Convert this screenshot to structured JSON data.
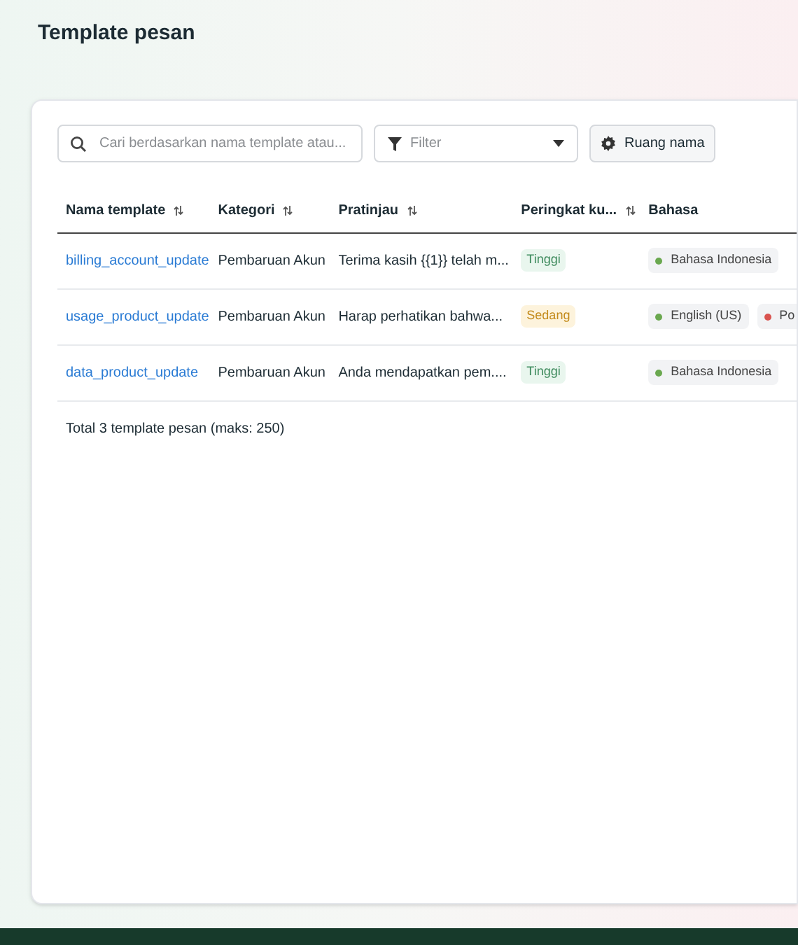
{
  "page_title": "Template pesan",
  "toolbar": {
    "search": {
      "placeholder": "Cari berdasarkan nama template atau..."
    },
    "filter": {
      "placeholder": "Filter"
    },
    "namespace_button": "Ruang nama"
  },
  "table": {
    "columns": [
      {
        "label": "Nama template",
        "sortable": true
      },
      {
        "label": "Kategori",
        "sortable": true
      },
      {
        "label": "Pratinjau",
        "sortable": true
      },
      {
        "label": "Peringkat ku...",
        "sortable": true
      },
      {
        "label": "Bahasa",
        "sortable": false
      }
    ],
    "rows": [
      {
        "name": "billing_account_update",
        "category": "Pembaruan Akun",
        "preview": "Terima kasih {{1}} telah m...",
        "quality": {
          "label": "Tinggi",
          "kind": "high"
        },
        "languages": [
          {
            "label": "Bahasa Indonesia",
            "color": "#6aa84f"
          }
        ]
      },
      {
        "name": "usage_product_update",
        "category": "Pembaruan Akun",
        "preview": "Harap perhatikan bahwa...",
        "quality": {
          "label": "Sedang",
          "kind": "medium"
        },
        "languages": [
          {
            "label": "English (US)",
            "color": "#6aa84f"
          },
          {
            "label": "Po",
            "color": "#d9534f"
          }
        ]
      },
      {
        "name": "data_product_update",
        "category": "Pembaruan Akun",
        "preview": "Anda mendapatkan pem....",
        "quality": {
          "label": "Tinggi",
          "kind": "high"
        },
        "languages": [
          {
            "label": "Bahasa Indonesia",
            "color": "#6aa84f"
          }
        ]
      }
    ]
  },
  "total": "Total 3 template pesan (maks: 250)"
}
